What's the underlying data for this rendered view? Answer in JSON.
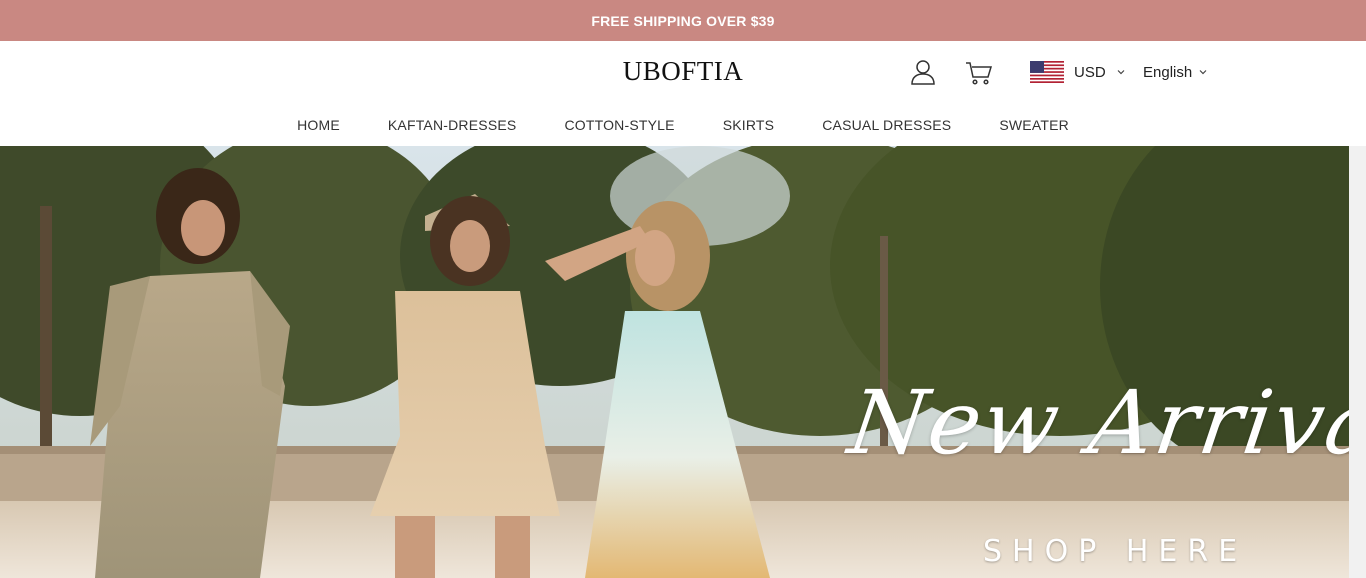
{
  "announcement": "FREE SHIPPING OVER $39",
  "header": {
    "logo": "UBOFTIA",
    "account_icon": "user-icon",
    "cart_icon": "cart-icon",
    "currency": "USD",
    "language": "English"
  },
  "nav": {
    "items": [
      {
        "label": "HOME"
      },
      {
        "label": "KAFTAN-DRESSES"
      },
      {
        "label": "COTTON-STYLE"
      },
      {
        "label": "SKIRTS"
      },
      {
        "label": "CASUAL DRESSES"
      },
      {
        "label": "SWEATER"
      }
    ]
  },
  "hero": {
    "title": "New Arrival",
    "cta": "SHOP HERE"
  },
  "colors": {
    "announcement_bg": "#c98882",
    "text": "#222222"
  }
}
